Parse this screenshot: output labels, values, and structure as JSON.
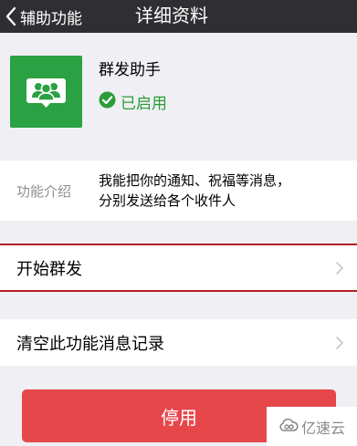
{
  "navbar": {
    "back_label": "辅助功能",
    "title": "详细资料"
  },
  "app": {
    "name": "群发助手",
    "status": "已启用",
    "icon": "group-people-icon",
    "status_icon": "check-circle-icon"
  },
  "intro": {
    "label": "功能介绍",
    "line1": "我能把你的通知、祝福等消息，",
    "line2": "分别发送给各个收件人"
  },
  "rows": {
    "start_label": "开始群发",
    "clear_label": "清空此功能消息记录"
  },
  "disable_button": {
    "label": "停用"
  },
  "watermark": {
    "text": "亿速云"
  },
  "colors": {
    "navbar": "#2f2f33",
    "icon_green": "#2aa142",
    "status_green": "#2c9c38",
    "danger_button": "#e6474b",
    "highlight": "#b21e24",
    "background": "#efeff4"
  }
}
